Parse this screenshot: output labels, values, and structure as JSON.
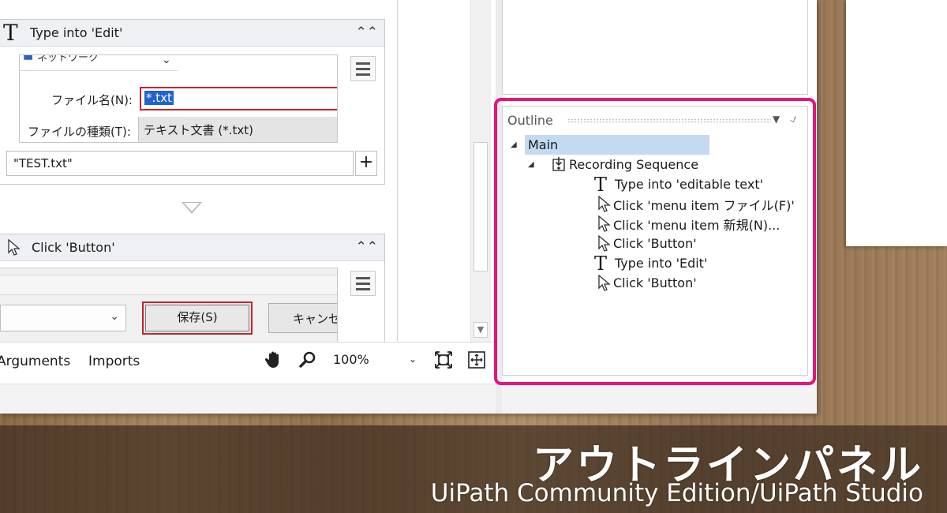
{
  "designer": {
    "activity1": {
      "title": "Type into 'Edit'",
      "screenshot": {
        "dropdown_text": "ネットワーク",
        "file_name_label": "ファイル名(N):",
        "file_name_value": "*.txt",
        "file_type_label": "ファイルの種類(T):",
        "file_type_value": "テキスト文書 (*.txt)"
      },
      "value_input": "\"TEST.txt\"",
      "add_label": "+"
    },
    "activity2": {
      "title": "Click 'Button'",
      "screenshot": {
        "save_button_label": "保存(S)",
        "cancel_button_label": "キャンセル"
      }
    }
  },
  "bottom_bar": {
    "tabs": [
      "Arguments",
      "Imports"
    ],
    "zoom": "100%"
  },
  "outline": {
    "title": "Outline",
    "tree": [
      {
        "label": "Main",
        "icon": "none",
        "indent": 0,
        "expanded": true
      },
      {
        "label": "Recording Sequence",
        "icon": "sequence-icon",
        "indent": 1,
        "expanded": true
      },
      {
        "label": "Type into 'editable text'",
        "icon": "type-into-icon",
        "indent": 2
      },
      {
        "label": "Click 'menu item  ファイル(F)'",
        "icon": "click-icon",
        "indent": 2
      },
      {
        "label": "Click 'menu item  新規(N)...",
        "icon": "click-icon",
        "indent": 2
      },
      {
        "label": "Click 'Button'",
        "icon": "click-icon",
        "indent": 2
      },
      {
        "label": "Type into 'Edit'",
        "icon": "type-into-icon",
        "indent": 2
      },
      {
        "label": "Click 'Button'",
        "icon": "click-icon",
        "indent": 2
      }
    ]
  },
  "caption": {
    "title": "アウトラインパネル",
    "subtitle": "UiPath Community Edition/UiPath Studio"
  },
  "colors": {
    "highlight": "#e2157a",
    "selection": "#c3daf2",
    "error_border": "#d21f2c"
  }
}
